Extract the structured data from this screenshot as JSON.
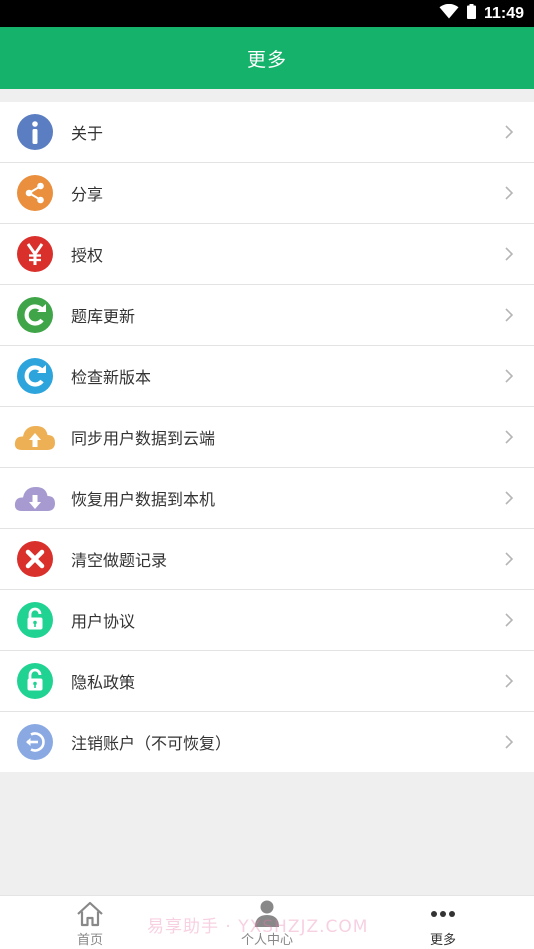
{
  "status_bar": {
    "time": "11:49",
    "icons": [
      "wifi-icon",
      "battery-icon"
    ]
  },
  "header": {
    "title": "更多",
    "color": "#15b26b"
  },
  "menu": {
    "items": [
      {
        "label": "关于",
        "icon": "info-icon",
        "color": "#5b7dc1"
      },
      {
        "label": "分享",
        "icon": "share-icon",
        "color": "#e98f3d"
      },
      {
        "label": "授权",
        "icon": "yen-icon",
        "color": "#d9302c"
      },
      {
        "label": "题库更新",
        "icon": "refresh-icon",
        "color": "#3fa548"
      },
      {
        "label": "检查新版本",
        "icon": "update-icon",
        "color": "#2ea4dc"
      },
      {
        "label": "同步用户数据到云端",
        "icon": "cloud-upload-icon",
        "color": "#eeb055"
      },
      {
        "label": "恢复用户数据到本机",
        "icon": "cloud-download-icon",
        "color": "#a79ad0"
      },
      {
        "label": "清空做题记录",
        "icon": "clear-icon",
        "color": "#d9302c"
      },
      {
        "label": "用户协议",
        "icon": "unlock-icon",
        "color": "#21d392"
      },
      {
        "label": "隐私政策",
        "icon": "unlock-icon",
        "color": "#21d392"
      },
      {
        "label": "注销账户（不可恢复）",
        "icon": "logout-icon",
        "color": "#8aa9e3"
      }
    ]
  },
  "bottom_nav": {
    "items": [
      {
        "label": "首页",
        "icon": "home-icon"
      },
      {
        "label": "个人中心",
        "icon": "user-icon"
      },
      {
        "label": "更多",
        "icon": "more-icon",
        "active": true
      }
    ]
  },
  "watermark": "易享助手 · YXSHZJZ.COM"
}
